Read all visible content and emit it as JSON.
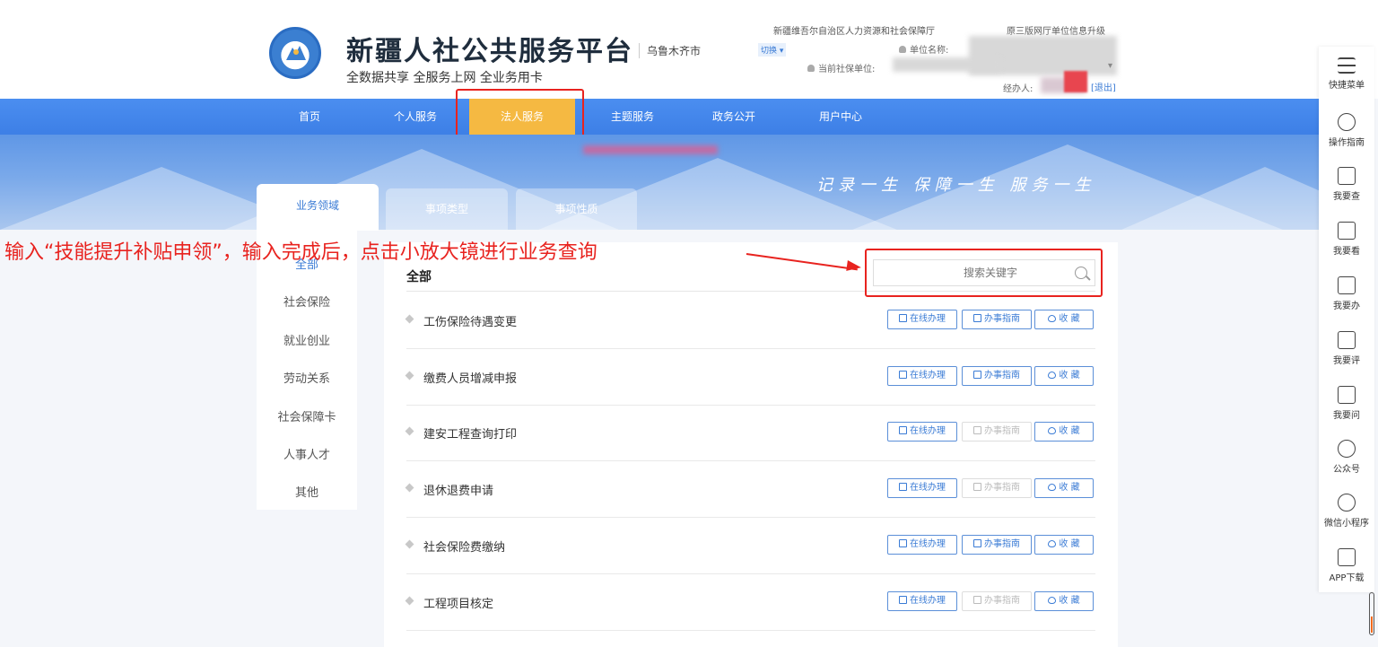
{
  "header": {
    "title": "新疆人社公共服务平台",
    "subtitle": "全数据共享 全服务上网 全业务用卡",
    "city": "乌鲁木齐市",
    "department": "新疆维吾尔自治区人力资源和社会保障厅",
    "upgrade_notice": "原三版网厅单位信息升级",
    "switch_label": "切换",
    "unit_name_label": "单位名称:",
    "current_unit_label": "当前社保单位:",
    "agent_label": "经办人:",
    "logout_label": "[退出]"
  },
  "nav": {
    "items": [
      "首页",
      "个人服务",
      "法人服务",
      "主题服务",
      "政务公开",
      "用户中心"
    ],
    "active": "法人服务"
  },
  "banner": {
    "slogan": "记录一生  保障一生  服务一生"
  },
  "tabs": [
    "业务领域",
    "事项类型",
    "事项性质"
  ],
  "left_menu": [
    "全部",
    "社会保险",
    "就业创业",
    "劳动关系",
    "社会保障卡",
    "人事人才",
    "其他"
  ],
  "annotation": "输入“技能提升补贴申领”，输入完成后，点击小放大镜进行业务查询",
  "main": {
    "title": "全部",
    "search_placeholder": "搜索关键字",
    "rows": [
      {
        "label": "工伤保险待遇变更",
        "guide_enabled": true
      },
      {
        "label": "缴费人员增减申报",
        "guide_enabled": true
      },
      {
        "label": "建安工程查询打印",
        "guide_enabled": false
      },
      {
        "label": "退休退费申请",
        "guide_enabled": false
      },
      {
        "label": "社会保险费缴纳",
        "guide_enabled": true
      },
      {
        "label": "工程项目核定",
        "guide_enabled": false
      }
    ],
    "buttons": {
      "online": "在线办理",
      "guide": "办事指南",
      "favorite": "收 藏"
    }
  },
  "sidebar": [
    {
      "label": "快捷菜单",
      "icon": "menu-icon"
    },
    {
      "label": "操作指南",
      "icon": "compass-icon"
    },
    {
      "label": "我要查",
      "icon": "search-doc-icon"
    },
    {
      "label": "我要看",
      "icon": "doc-icon"
    },
    {
      "label": "我要办",
      "icon": "file-icon"
    },
    {
      "label": "我要评",
      "icon": "edit-icon"
    },
    {
      "label": "我要问",
      "icon": "chat-icon"
    },
    {
      "label": "公众号",
      "icon": "wechat-icon"
    },
    {
      "label": "微信小程序",
      "icon": "miniprogram-icon"
    },
    {
      "label": "APP下载",
      "icon": "app-icon"
    }
  ],
  "colors": {
    "nav_blue": "#3d7fe6",
    "nav_active": "#f5b942",
    "accent_blue": "#3a7bd5",
    "annotation_red": "#e8231f"
  }
}
